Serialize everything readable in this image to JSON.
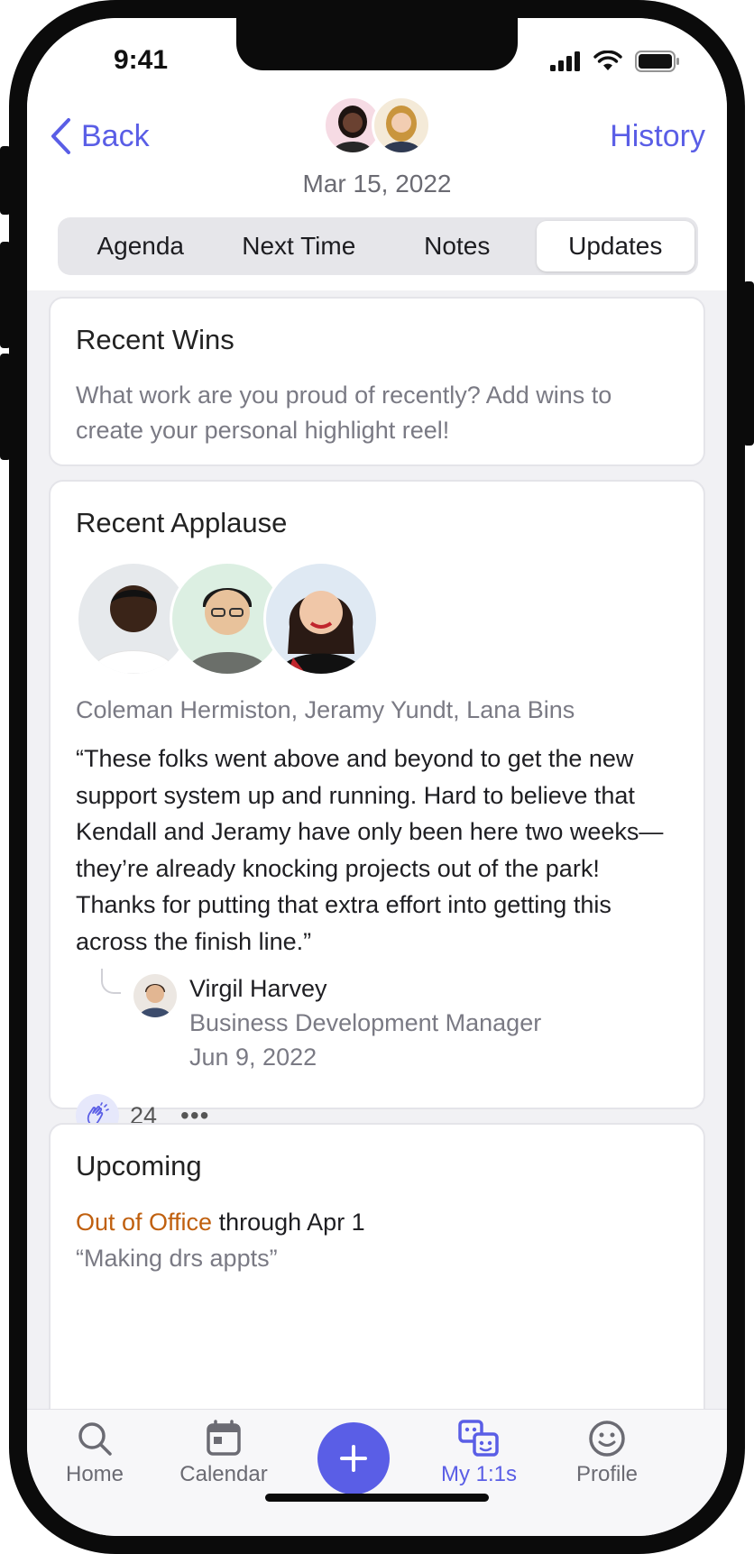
{
  "status": {
    "time": "9:41"
  },
  "header": {
    "back_label": "Back",
    "history_label": "History",
    "date": "Mar 15, 2022"
  },
  "tabs": [
    {
      "label": "Agenda",
      "active": false
    },
    {
      "label": "Next Time",
      "active": false
    },
    {
      "label": "Notes",
      "active": false
    },
    {
      "label": "Updates",
      "active": true
    }
  ],
  "recent_wins": {
    "title": "Recent Wins",
    "text": "What work are you proud of recently? Add wins to create your personal highlight reel!"
  },
  "recent_applause": {
    "title": "Recent Applause",
    "names": "Coleman Hermiston, Jeramy Yundt, Lana Bins",
    "quote": "“These folks went above and beyond to get the new support system up and running. Hard to believe that Kendall and Jeramy have only been here two weeks—they’re already knocking projects out of the park! Thanks for putting that extra effort into getting this across the finish line.”",
    "author_name": "Virgil Harvey",
    "author_title": "Business Development Manager",
    "author_date": "Jun 9, 2022",
    "reaction_count": "24",
    "more_label": "•••"
  },
  "upcoming": {
    "title": "Upcoming",
    "status": "Out of Office",
    "through": " through Apr 1",
    "note": "“Making drs appts”"
  },
  "tabbar": {
    "home": "Home",
    "calendar": "Calendar",
    "my11s": "My 1:1s",
    "profile": "Profile"
  },
  "colors": {
    "accent": "#5a5ee6",
    "ooo": "#c0600f",
    "background": "#f1f1f4"
  }
}
